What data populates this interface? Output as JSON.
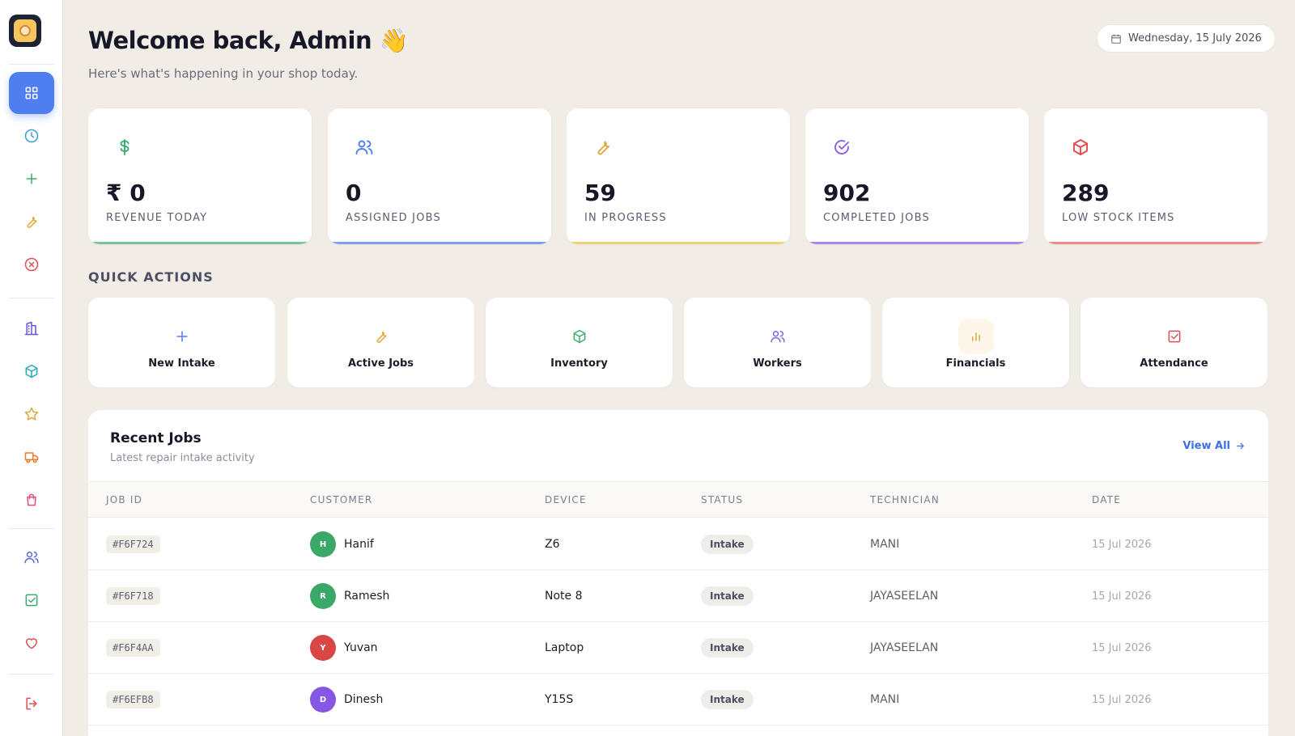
{
  "header": {
    "welcome": "Welcome back, Admin 👋",
    "subtitle": "Here's what's happening in your shop today.",
    "date": "Wednesday, 15 July 2026"
  },
  "stats": [
    {
      "icon": "dollar-icon",
      "value": "₹ 0",
      "label": "REVENUE TODAY",
      "color": "#3dab6f",
      "bar": "#73c994"
    },
    {
      "icon": "users-icon",
      "value": "0",
      "label": "ASSIGNED JOBS",
      "color": "#4f7ef0",
      "bar": "#7aa0f2"
    },
    {
      "icon": "wrench-icon",
      "value": "59",
      "label": "IN PROGRESS",
      "color": "#e0a73a",
      "bar": "#f1cf74"
    },
    {
      "icon": "check-circle-icon",
      "value": "902",
      "label": "COMPLETED JOBS",
      "color": "#8a5ee8",
      "bar": "#a884ec"
    },
    {
      "icon": "box-icon",
      "value": "289",
      "label": "LOW STOCK ITEMS",
      "color": "#e04f4f",
      "bar": "#ee8a8a"
    }
  ],
  "quick_actions": {
    "title": "QUICK ACTIONS",
    "items": [
      {
        "icon": "plus-icon",
        "label": "New Intake",
        "color": "#4f7ef0",
        "bg": "#ffffff"
      },
      {
        "icon": "wrench-icon",
        "label": "Active Jobs",
        "color": "#e0a73a",
        "bg": "#ffffff"
      },
      {
        "icon": "box-icon",
        "label": "Inventory",
        "color": "#3dab6f",
        "bg": "#ffffff"
      },
      {
        "icon": "users-icon",
        "label": "Workers",
        "color": "#8a5ee8",
        "bg": "#ffffff"
      },
      {
        "icon": "bar-chart-icon",
        "label": "Financials",
        "color": "#e0a73a",
        "bg": "#fdf6ea"
      },
      {
        "icon": "check-square-icon",
        "label": "Attendance",
        "color": "#e04f4f",
        "bg": "#ffffff"
      }
    ]
  },
  "recent_jobs": {
    "title": "Recent Jobs",
    "subtitle": "Latest repair intake activity",
    "view_all": "View All",
    "columns": [
      "JOB ID",
      "CUSTOMER",
      "DEVICE",
      "STATUS",
      "TECHNICIAN",
      "DATE"
    ],
    "rows": [
      {
        "id": "#F6F724",
        "initial": "H",
        "avatar_color": "#3aa866",
        "customer": "Hanif",
        "device": "Z6",
        "status": "Intake",
        "technician": "MANI",
        "date": "15 Jul 2026"
      },
      {
        "id": "#F6F718",
        "initial": "R",
        "avatar_color": "#3aa866",
        "customer": "Ramesh",
        "device": "Note 8",
        "status": "Intake",
        "technician": "JAYASEELAN",
        "date": "15 Jul 2026"
      },
      {
        "id": "#F6F4AA",
        "initial": "Y",
        "avatar_color": "#d94646",
        "customer": "Yuvan",
        "device": "Laptop",
        "status": "Intake",
        "technician": "JAYASEELAN",
        "date": "15 Jul 2026"
      },
      {
        "id": "#F6EFB8",
        "initial": "D",
        "avatar_color": "#8656e6",
        "customer": "Dinesh",
        "device": "Y15S",
        "status": "Intake",
        "technician": "MANI",
        "date": "15 Jul 2026"
      }
    ]
  },
  "sidebar": {
    "items": [
      {
        "icon": "grid-icon",
        "name": "dashboard",
        "color": "#ffffff",
        "active": true
      },
      {
        "icon": "clock-icon",
        "name": "history",
        "color": "#3a9fd0"
      },
      {
        "icon": "plus-icon",
        "name": "new-intake",
        "color": "#3dab6f"
      },
      {
        "icon": "wrench-icon",
        "name": "jobs",
        "color": "#e0a73a"
      },
      {
        "icon": "x-circle-icon",
        "name": "cancelled",
        "color": "#e04f4f"
      },
      {
        "icon": "building-icon",
        "name": "shop",
        "color": "#6a52d8"
      },
      {
        "icon": "box-icon",
        "name": "inventory",
        "color": "#2aa7b8"
      },
      {
        "icon": "star-icon",
        "name": "favorites",
        "color": "#e0a73a"
      },
      {
        "icon": "truck-icon",
        "name": "delivery",
        "color": "#ea7a2f"
      },
      {
        "icon": "bag-icon",
        "name": "shopping",
        "color": "#e04f7a"
      },
      {
        "icon": "users-icon",
        "name": "workers",
        "color": "#5a6bd0"
      },
      {
        "icon": "check-square-icon",
        "name": "attendance",
        "color": "#3dab6f"
      },
      {
        "icon": "heart-icon",
        "name": "wishlist",
        "color": "#e04f4f"
      },
      {
        "icon": "logout-icon",
        "name": "logout",
        "color": "#e04f4f"
      }
    ]
  }
}
